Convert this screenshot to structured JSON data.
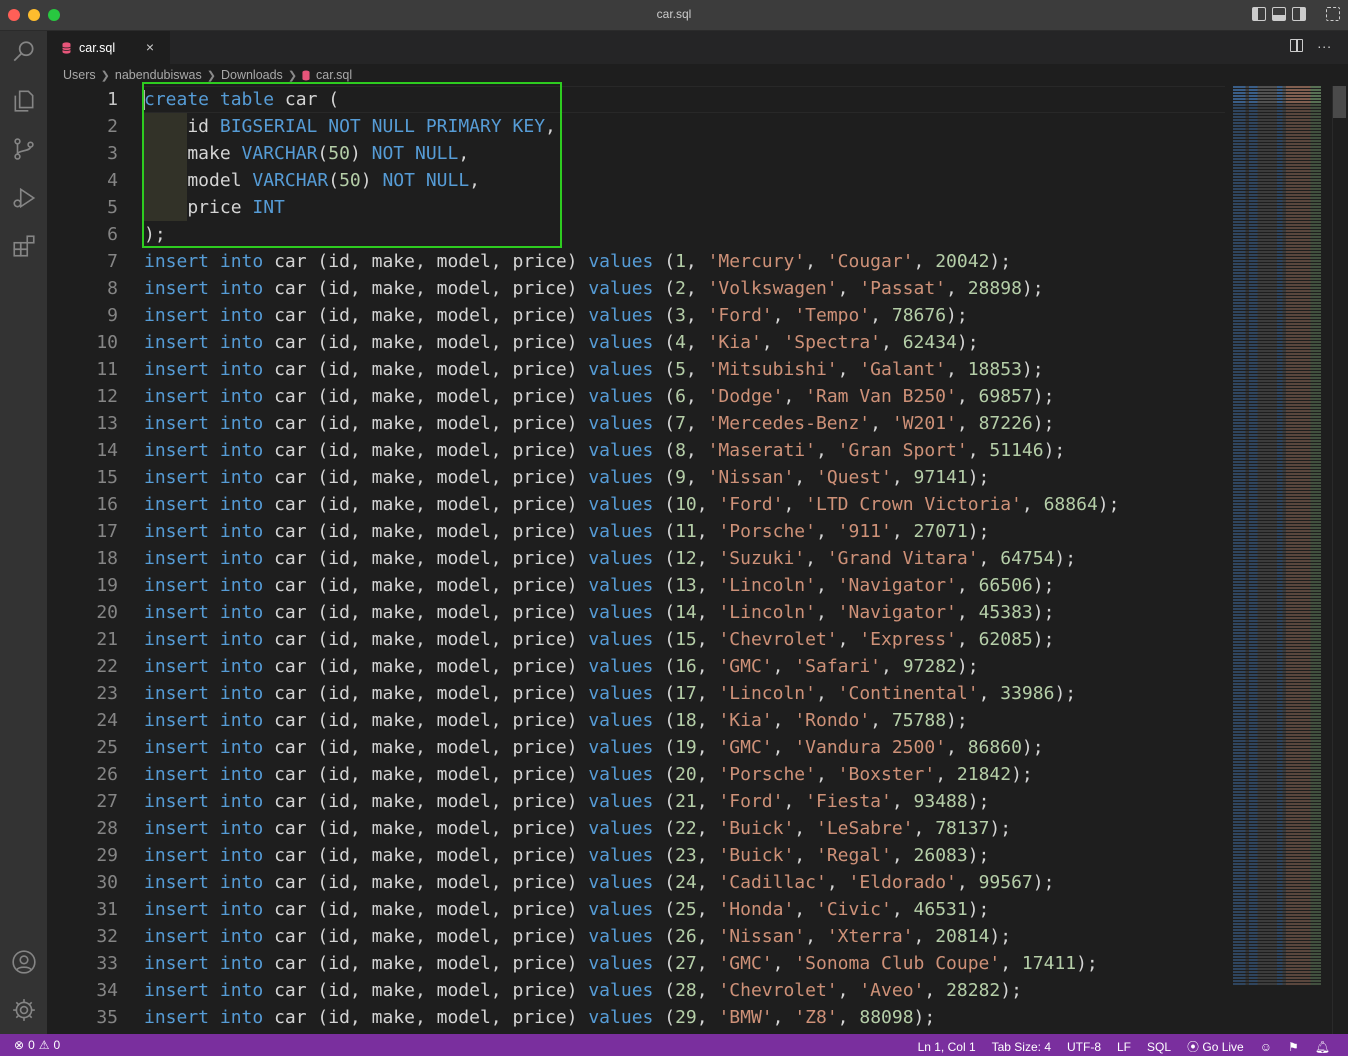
{
  "window": {
    "title": "car.sql"
  },
  "activity_bar": [
    "explorer",
    "search",
    "source-control",
    "run-debug",
    "extensions"
  ],
  "tab": {
    "label": "car.sql",
    "close": "×"
  },
  "breadcrumb": [
    "Users",
    "nabendubiswas",
    "Downloads",
    "car.sql"
  ],
  "editor": {
    "active_line": 1,
    "lines": [
      [
        [
          "kw",
          "create"
        ],
        [
          "punc",
          " "
        ],
        [
          "kw",
          "table"
        ],
        [
          "punc",
          " car ("
        ]
      ],
      [
        [
          "punc",
          "    id "
        ],
        [
          "kw",
          "BIGSERIAL"
        ],
        [
          "punc",
          " "
        ],
        [
          "kw",
          "NOT"
        ],
        [
          "punc",
          " "
        ],
        [
          "kw",
          "NULL"
        ],
        [
          "punc",
          " "
        ],
        [
          "kw",
          "PRIMARY"
        ],
        [
          "punc",
          " "
        ],
        [
          "kw",
          "KEY"
        ],
        [
          "punc",
          ","
        ]
      ],
      [
        [
          "punc",
          "    make "
        ],
        [
          "kw",
          "VARCHAR"
        ],
        [
          "punc",
          "("
        ],
        [
          "num",
          "50"
        ],
        [
          "punc",
          ") "
        ],
        [
          "kw",
          "NOT"
        ],
        [
          "punc",
          " "
        ],
        [
          "kw",
          "NULL"
        ],
        [
          "punc",
          ","
        ]
      ],
      [
        [
          "punc",
          "    model "
        ],
        [
          "kw",
          "VARCHAR"
        ],
        [
          "punc",
          "("
        ],
        [
          "num",
          "50"
        ],
        [
          "punc",
          ") "
        ],
        [
          "kw",
          "NOT"
        ],
        [
          "punc",
          " "
        ],
        [
          "kw",
          "NULL"
        ],
        [
          "punc",
          ","
        ]
      ],
      [
        [
          "punc",
          "    price "
        ],
        [
          "kw",
          "INT"
        ]
      ],
      [
        [
          "punc",
          ");"
        ]
      ]
    ],
    "insert_template": {
      "kw1": "insert",
      "kw2": "into",
      "table_cols": " car (id, make, model, price) ",
      "kw3": "values"
    },
    "inserts": [
      [
        1,
        "Mercury",
        "Cougar",
        20042
      ],
      [
        2,
        "Volkswagen",
        "Passat",
        28898
      ],
      [
        3,
        "Ford",
        "Tempo",
        78676
      ],
      [
        4,
        "Kia",
        "Spectra",
        62434
      ],
      [
        5,
        "Mitsubishi",
        "Galant",
        18853
      ],
      [
        6,
        "Dodge",
        "Ram Van B250",
        69857
      ],
      [
        7,
        "Mercedes-Benz",
        "W201",
        87226
      ],
      [
        8,
        "Maserati",
        "Gran Sport",
        51146
      ],
      [
        9,
        "Nissan",
        "Quest",
        97141
      ],
      [
        10,
        "Ford",
        "LTD Crown Victoria",
        68864
      ],
      [
        11,
        "Porsche",
        "911",
        27071
      ],
      [
        12,
        "Suzuki",
        "Grand Vitara",
        64754
      ],
      [
        13,
        "Lincoln",
        "Navigator",
        66506
      ],
      [
        14,
        "Lincoln",
        "Navigator",
        45383
      ],
      [
        15,
        "Chevrolet",
        "Express",
        62085
      ],
      [
        16,
        "GMC",
        "Safari",
        97282
      ],
      [
        17,
        "Lincoln",
        "Continental",
        33986
      ],
      [
        18,
        "Kia",
        "Rondo",
        75788
      ],
      [
        19,
        "GMC",
        "Vandura 2500",
        86860
      ],
      [
        20,
        "Porsche",
        "Boxster",
        21842
      ],
      [
        21,
        "Ford",
        "Fiesta",
        93488
      ],
      [
        22,
        "Buick",
        "LeSabre",
        78137
      ],
      [
        23,
        "Buick",
        "Regal",
        26083
      ],
      [
        24,
        "Cadillac",
        "Eldorado",
        99567
      ],
      [
        25,
        "Honda",
        "Civic",
        46531
      ],
      [
        26,
        "Nissan",
        "Xterra",
        20814
      ],
      [
        27,
        "GMC",
        "Sonoma Club Coupe",
        17411
      ],
      [
        28,
        "Chevrolet",
        "Aveo",
        28282
      ],
      [
        29,
        "BMW",
        "Z8",
        88098
      ]
    ]
  },
  "status_bar": {
    "errors": "0",
    "warnings": "0",
    "cursor": "Ln 1, Col 1",
    "tab_size": "Tab Size: 4",
    "encoding": "UTF-8",
    "eol": "LF",
    "language": "SQL",
    "go_live": "Go Live"
  },
  "colors": {
    "keyword": "#569cd6",
    "string": "#ce9178",
    "number": "#b5cea8",
    "status_bar": "#7a2f9e",
    "highlight_box": "#2ecc20"
  }
}
